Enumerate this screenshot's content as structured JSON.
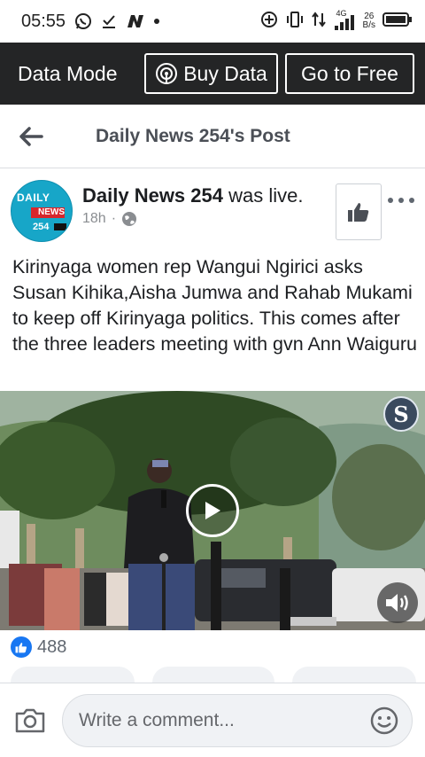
{
  "status_bar": {
    "time": "05:55",
    "network_label": "4G",
    "net_speed_value": "26",
    "net_speed_unit": "B/s"
  },
  "data_bar": {
    "mode_label": "Data Mode",
    "buy_data_label": "Buy Data",
    "go_free_label": "Go to Free"
  },
  "header": {
    "title": "Daily News 254's Post"
  },
  "post": {
    "author_name": "Daily News 254",
    "author_suffix": " was live.",
    "time_ago": "18h",
    "separator": "·",
    "text": "Kirinyaga women rep Wangui Ngirici asks Susan Kihika,Aisha Jumwa and Rahab Mukami to keep off  Kirinyaga politics. This comes after the three leaders meeting with gvn Ann Waiguru",
    "avatar_text_top": "DAILY",
    "avatar_text_mid": "NEWS",
    "avatar_text_num": "254",
    "video_logo_letter": "S"
  },
  "reactions": {
    "count": "488"
  },
  "comment_bar": {
    "placeholder": "Write a comment..."
  },
  "colors": {
    "data_bar_bg": "#242526",
    "like_blue": "#1877f2",
    "header_text": "#4b4f56"
  }
}
